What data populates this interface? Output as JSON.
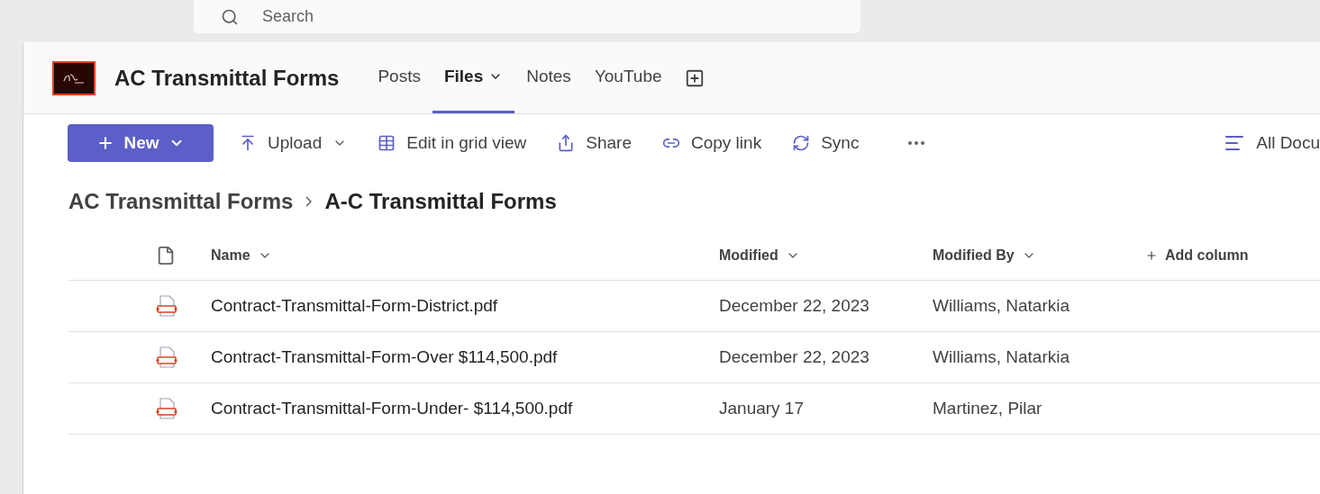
{
  "search": {
    "placeholder": "Search"
  },
  "channel": {
    "title": "AC Transmittal Forms"
  },
  "tabs": [
    {
      "label": "Posts",
      "selected": false,
      "dropdown": false
    },
    {
      "label": "Files",
      "selected": true,
      "dropdown": true
    },
    {
      "label": "Notes",
      "selected": false,
      "dropdown": false
    },
    {
      "label": "YouTube",
      "selected": false,
      "dropdown": false
    }
  ],
  "toolbar": {
    "new_button": "New",
    "actions": [
      {
        "kind": "upload",
        "label": "Upload",
        "dropdown": true
      },
      {
        "kind": "grid",
        "label": "Edit in grid view",
        "dropdown": false
      },
      {
        "kind": "share",
        "label": "Share",
        "dropdown": false
      },
      {
        "kind": "link",
        "label": "Copy link",
        "dropdown": false
      },
      {
        "kind": "sync",
        "label": "Sync",
        "dropdown": false
      }
    ],
    "view": "All Docu"
  },
  "breadcrumb": [
    "AC Transmittal Forms",
    "A-C Transmittal Forms"
  ],
  "table": {
    "columns": [
      "Name",
      "Modified",
      "Modified By"
    ],
    "add_column": "Add column",
    "rows": [
      {
        "name": "Contract-Transmittal-Form-District.pdf",
        "modified": "December 22, 2023",
        "modified_by": "Williams, Natarkia"
      },
      {
        "name": "Contract-Transmittal-Form-Over $114,500.pdf",
        "modified": "December 22, 2023",
        "modified_by": "Williams, Natarkia"
      },
      {
        "name": "Contract-Transmittal-Form-Under- $114,500.pdf",
        "modified": "January 17",
        "modified_by": "Martinez, Pilar"
      }
    ]
  }
}
